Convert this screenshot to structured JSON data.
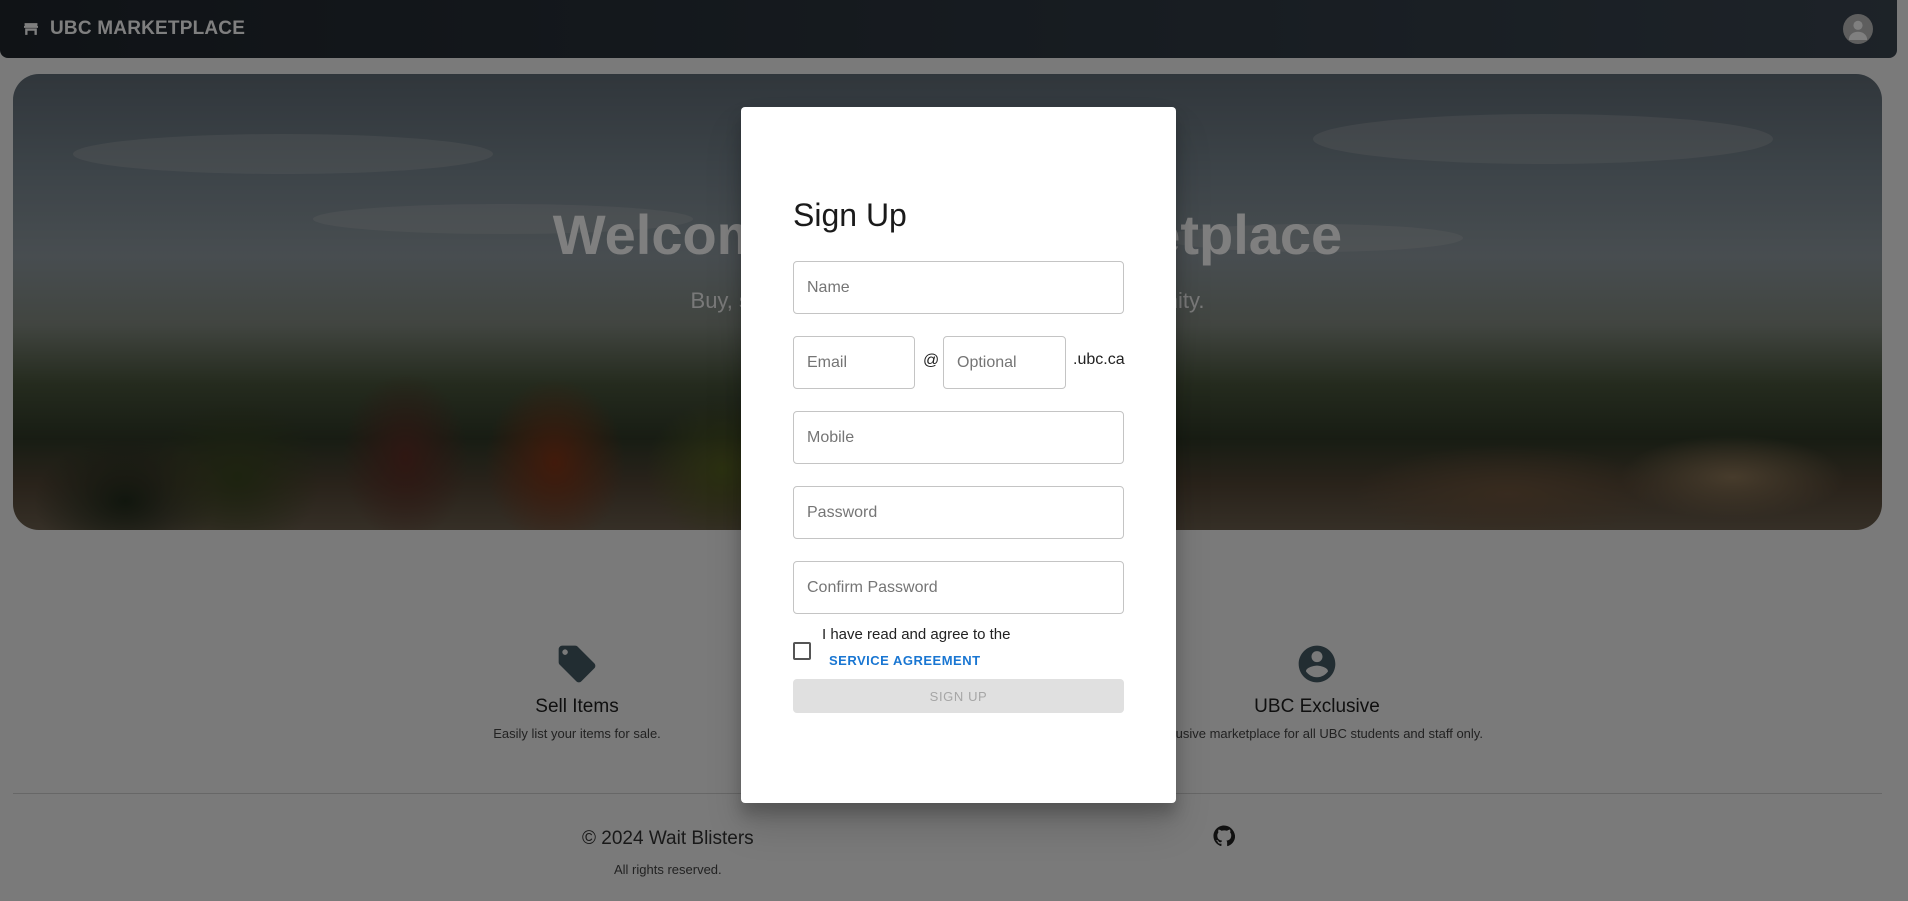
{
  "appbar": {
    "brand_icon": "store-icon",
    "brand_title": "UBC MARKETPLACE",
    "avatar_icon": "account-avatar-icon"
  },
  "hero": {
    "title": "Welcome to UBC Marketplace",
    "subtitle": "Buy, sell, and trade items within the UBC community."
  },
  "features": [
    {
      "icon": "tag-icon",
      "title": "Sell Items",
      "description": "Easily list your items for sale."
    },
    {
      "icon": "account-circle-icon",
      "title": "UBC Exclusive",
      "description": "Exclusive marketplace for all UBC students and staff only."
    }
  ],
  "footer": {
    "copyright": "© 2024 Wait Blisters",
    "rights": "All rights reserved.",
    "github_icon": "github-icon"
  },
  "signup_dialog": {
    "title": "Sign Up",
    "name_placeholder": "Name",
    "email_placeholder": "Email",
    "at_symbol": "@",
    "optional_placeholder": "Optional",
    "domain_suffix": ".ubc.ca",
    "mobile_placeholder": "Mobile",
    "password_placeholder": "Password",
    "confirm_password_placeholder": "Confirm Password",
    "agreement_checked": false,
    "agreement_text": "I have read and agree to the",
    "agreement_link": "SERVICE AGREEMENT",
    "submit_label": "SIGN UP",
    "submit_disabled": true
  },
  "colors": {
    "appbar_dark": "#20262d",
    "link_blue": "#1976d2",
    "disabled_button": "#e0e0e0",
    "feature_icon": "#455a64"
  }
}
